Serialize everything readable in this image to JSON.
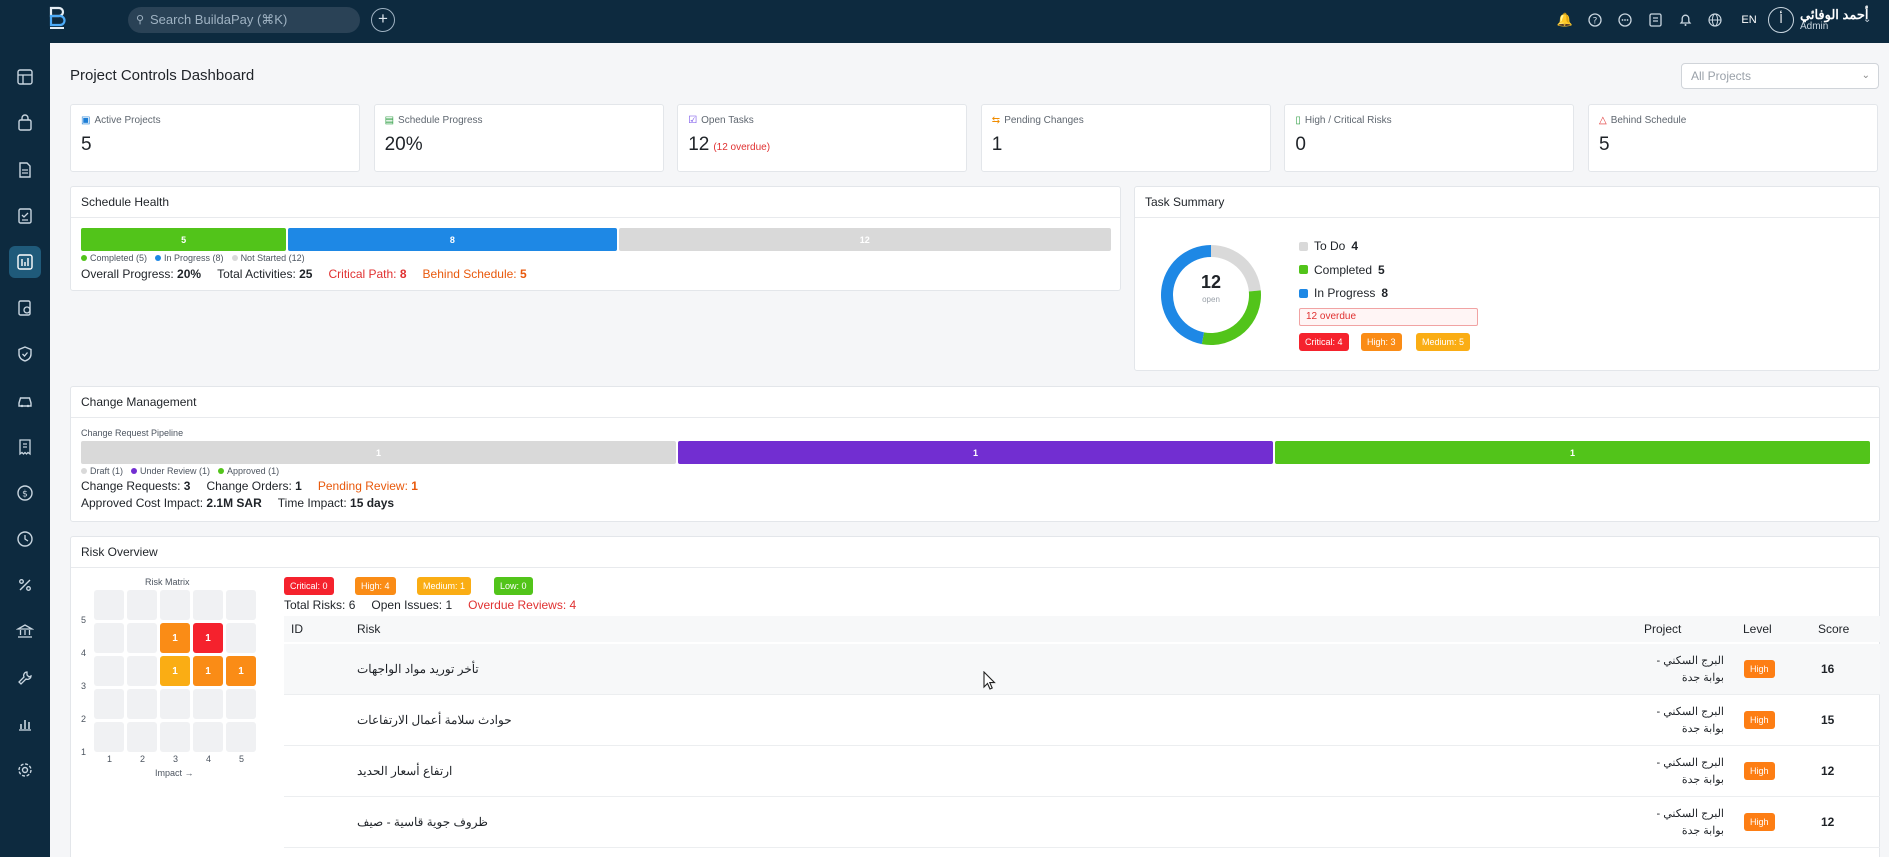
{
  "topbar": {
    "search_placeholder": "Search BuildaPay (⌘K)",
    "lang": "EN",
    "user_name": "أحمد الوفائي",
    "user_role": "Admin",
    "avatar_initials": "أ"
  },
  "page": {
    "title": "Project Controls Dashboard",
    "project_filter": "All Projects"
  },
  "kpis": [
    {
      "label": "Active Projects",
      "value": "5",
      "sub": "",
      "icon_color": "#1c7ed6"
    },
    {
      "label": "Schedule Progress",
      "value": "20%",
      "sub": "",
      "icon_color": "#2f9e44"
    },
    {
      "label": "Open Tasks",
      "value": "12",
      "sub": "(12 overdue)",
      "icon_color": "#7048e8"
    },
    {
      "label": "Pending Changes",
      "value": "1",
      "sub": "",
      "icon_color": "#f08c00"
    },
    {
      "label": "High / Critical Risks",
      "value": "0",
      "sub": "",
      "icon_color": "#2f9e44"
    },
    {
      "label": "Behind Schedule",
      "value": "5",
      "sub": "",
      "icon_color": "#e03131"
    }
  ],
  "schedule_health": {
    "title": "Schedule Health",
    "segments": [
      {
        "label": "5",
        "value": 5,
        "color": "#52c41a"
      },
      {
        "label": "8",
        "value": 8,
        "color": "#1e88e5"
      },
      {
        "label": "12",
        "value": 12,
        "color": "#d9d9d9"
      }
    ],
    "legend": [
      {
        "label": "Completed (5)",
        "color": "#52c41a"
      },
      {
        "label": "In Progress (8)",
        "color": "#1e88e5"
      },
      {
        "label": "Not Started (12)",
        "color": "#d9d9d9"
      }
    ],
    "overall_label": "Overall Progress:",
    "overall_value": "20%",
    "total_label": "Total Activities:",
    "total_value": "25",
    "critical_label": "Critical Path:",
    "critical_value": "8",
    "behind_label": "Behind Schedule:",
    "behind_value": "5"
  },
  "task_summary": {
    "title": "Task Summary",
    "center_value": "12",
    "center_label": "open",
    "segments": [
      {
        "label": "To Do",
        "value": 4,
        "color": "#d9d9d9"
      },
      {
        "label": "Completed",
        "value": 5,
        "color": "#52c41a"
      },
      {
        "label": "In Progress",
        "value": 8,
        "color": "#1e88e5"
      }
    ],
    "legend": [
      {
        "label": "To Do",
        "value": "4",
        "color": "#d9d9d9"
      },
      {
        "label": "Completed",
        "value": "5",
        "color": "#52c41a"
      },
      {
        "label": "In Progress",
        "value": "8",
        "color": "#1e88e5"
      }
    ],
    "overdue_tag": "12 overdue",
    "badges": [
      {
        "label": "Critical: 4",
        "color": "#f5222d"
      },
      {
        "label": "High: 3",
        "color": "#fa8c16"
      },
      {
        "label": "Medium: 5",
        "color": "#faad14"
      }
    ]
  },
  "change_management": {
    "title": "Change Management",
    "pipeline_label": "Change Request Pipeline",
    "segments": [
      {
        "label": "1",
        "value": 1,
        "color": "#d9d9d9"
      },
      {
        "label": "1",
        "value": 1,
        "color": "#722ed1"
      },
      {
        "label": "1",
        "value": 1,
        "color": "#52c41a"
      }
    ],
    "legend": [
      {
        "label": "Draft (1)",
        "color": "#d9d9d9"
      },
      {
        "label": "Under Review (1)",
        "color": "#722ed1"
      },
      {
        "label": "Approved (1)",
        "color": "#52c41a"
      }
    ],
    "requests_label": "Change Requests:",
    "requests_value": "3",
    "orders_label": "Change Orders:",
    "orders_value": "1",
    "pending_label": "Pending Review:",
    "pending_value": "1",
    "cost_label": "Approved Cost Impact:",
    "cost_value": "2.1M SAR",
    "time_label": "Time Impact:",
    "time_value": "15 days"
  },
  "risk_overview": {
    "title": "Risk Overview",
    "matrix_title": "Risk Matrix",
    "matrix_x_label": "Impact →",
    "matrix_x_ticks": [
      "1",
      "2",
      "3",
      "4",
      "5"
    ],
    "matrix_y_ticks": [
      "5",
      "4",
      "3",
      "2",
      "1"
    ],
    "matrix_cells": [
      {
        "impact": 3,
        "likelihood": 4,
        "count": "1",
        "color": "#fa8c16"
      },
      {
        "impact": 4,
        "likelihood": 4,
        "count": "1",
        "color": "#f5222d"
      },
      {
        "impact": 3,
        "likelihood": 3,
        "count": "1",
        "color": "#faad14"
      },
      {
        "impact": 4,
        "likelihood": 3,
        "count": "1",
        "color": "#fa8c16"
      },
      {
        "impact": 5,
        "likelihood": 3,
        "count": "1",
        "color": "#fa8c16"
      }
    ],
    "badges": [
      {
        "label": "Critical: 0",
        "color": "#f5222d"
      },
      {
        "label": "High: 4",
        "color": "#fa8c16"
      },
      {
        "label": "Medium: 1",
        "color": "#faad14"
      },
      {
        "label": "Low: 0",
        "color": "#52c41a"
      }
    ],
    "total_label": "Total Risks:",
    "total_value": "6",
    "issues_label": "Open Issues:",
    "issues_value": "1",
    "overdue_label": "Overdue Reviews:",
    "overdue_value": "4",
    "columns": [
      "ID",
      "Risk",
      "Project",
      "Level",
      "Score"
    ],
    "rows": [
      {
        "id": "",
        "risk": "تأخر توريد مواد الواجهات",
        "project": "البرج السكني - بوابة جدة",
        "level": "High",
        "score": "16"
      },
      {
        "id": "",
        "risk": "حوادث سلامة أعمال الارتفاعات",
        "project": "البرج السكني - بوابة جدة",
        "level": "High",
        "score": "15"
      },
      {
        "id": "",
        "risk": "ارتفاع أسعار الحديد",
        "project": "البرج السكني - بوابة جدة",
        "level": "High",
        "score": "12"
      },
      {
        "id": "",
        "risk": "ظروف جوية قاسية - صيف",
        "project": "البرج السكني - بوابة جدة",
        "level": "High",
        "score": "12"
      }
    ]
  }
}
